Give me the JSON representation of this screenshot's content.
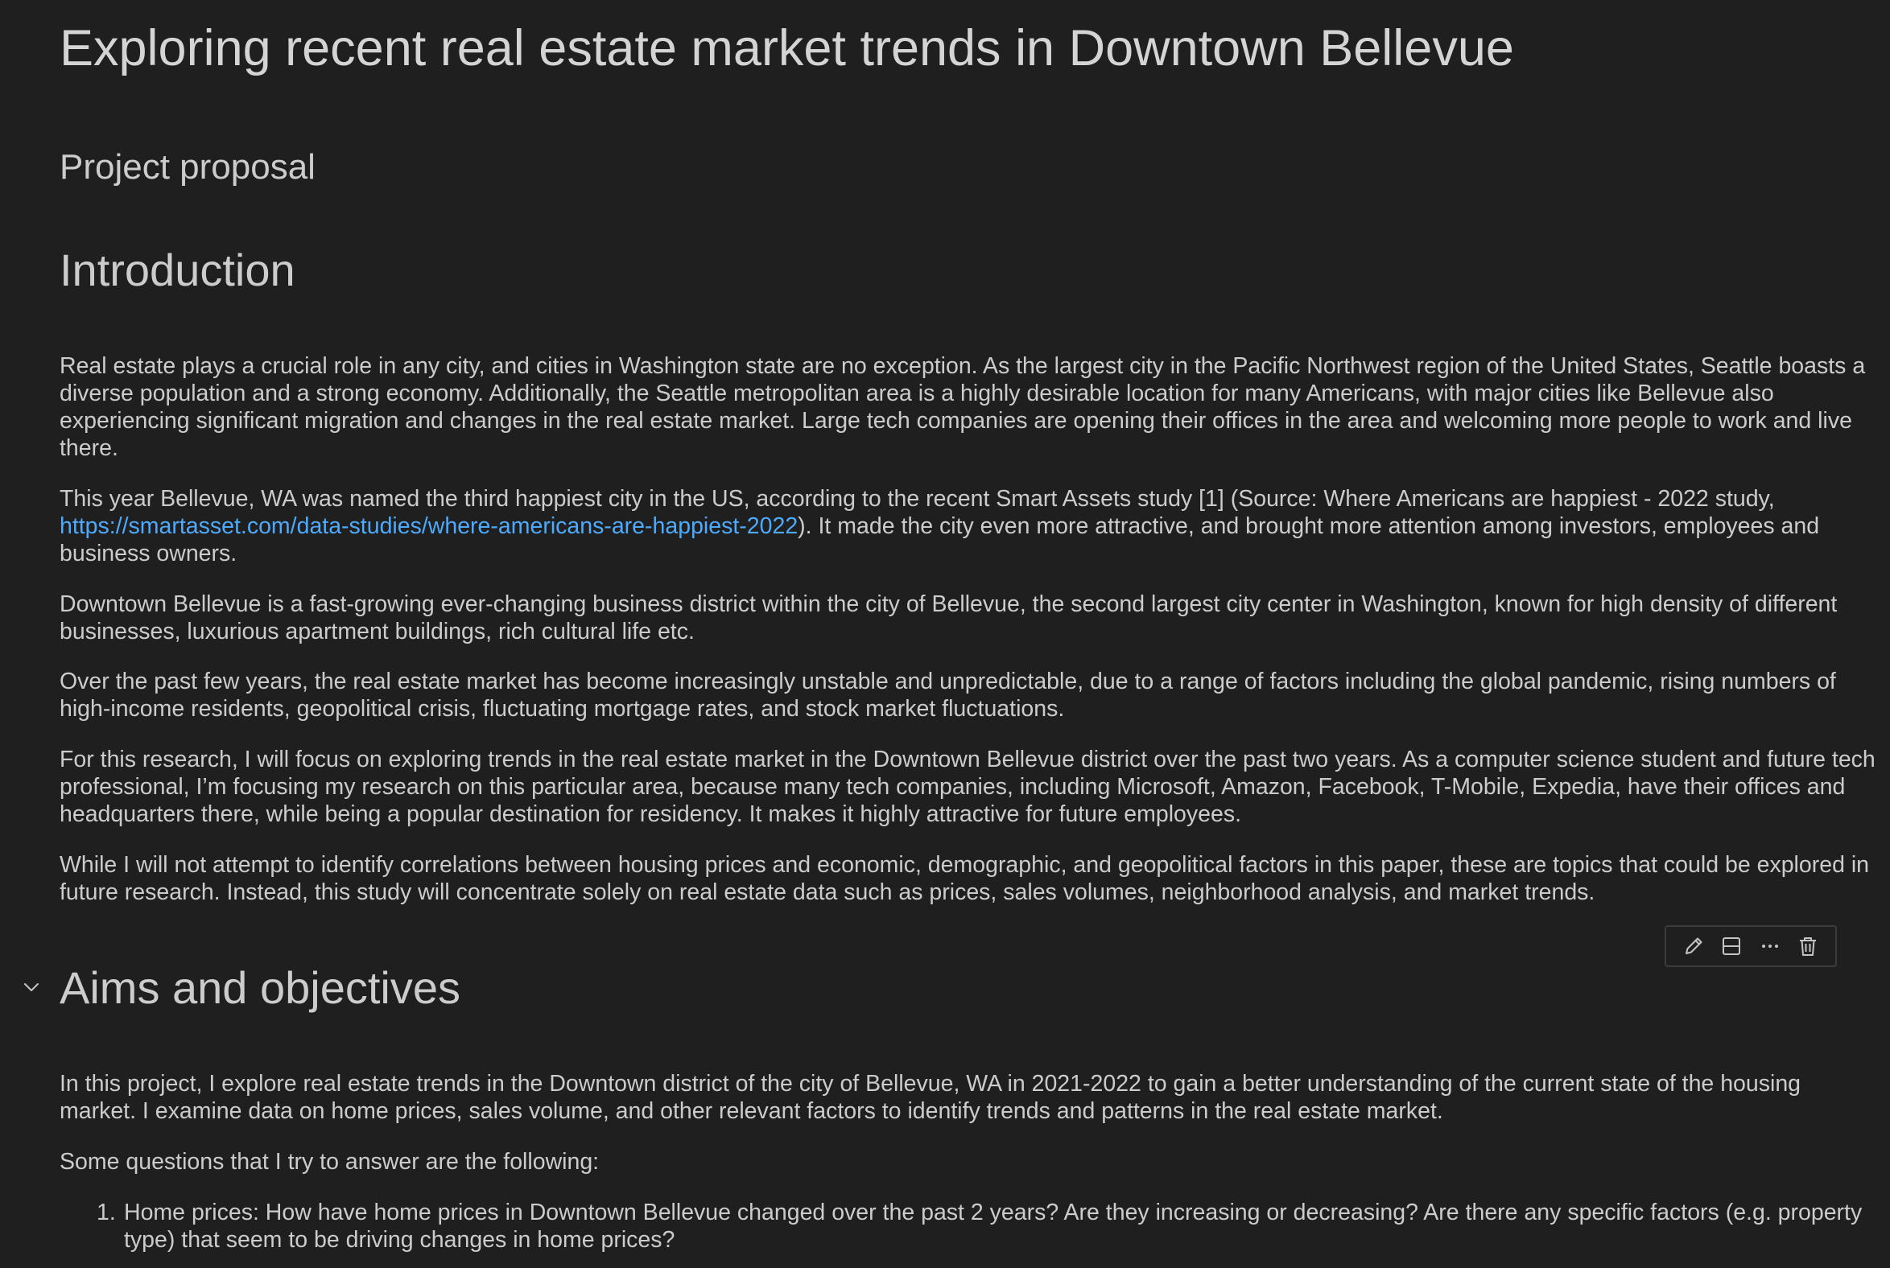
{
  "notebook": {
    "title": "Exploring recent real estate market trends in Downtown Bellevue",
    "subtitle": "Project proposal",
    "introduction": {
      "heading": "Introduction",
      "paragraphs": [
        "Real estate plays a crucial role in any city, and cities in Washington state are no exception. As the largest city in the Pacific Northwest region of the United States, Seattle boasts a diverse population and a strong economy. Additionally, the Seattle metropolitan area is a highly desirable location for many Americans, with major cities like Bellevue also experiencing significant migration and changes in the real estate market. Large tech companies are opening their offices in the area and welcoming more people to work and live there.",
        "Downtown Bellevue is a fast-growing ever-changing business district within the city of Bellevue, the second largest city center in Washington, known for high density of different businesses, luxurious apartment buildings, rich cultural life etc.",
        "Over the past few years, the real estate market has become increasingly unstable and unpredictable, due to a range of factors including the global pandemic, rising numbers of high-income residents, geopolitical crisis, fluctuating mortgage rates, and stock market fluctuations.",
        "For this research, I will focus on exploring trends in the real estate market in the Downtown Bellevue district over the past two years. As a computer science student and future tech professional, I’m focusing my research on this particular area, because many tech companies, including Microsoft, Amazon, Facebook, T-Mobile, Expedia, have their offices and headquarters there, while being a popular destination for residency. It makes it highly attractive for future employees.",
        "While I will not attempt to identify correlations between housing prices and economic, demographic, and geopolitical factors in this paper, these are topics that could be explored in future research. Instead, this study will concentrate solely on real estate data such as prices, sales volumes, neighborhood analysis, and market trends."
      ],
      "link_paragraph": {
        "before": "This year Bellevue, WA was named the third happiest city in the US, according to the recent Smart Assets study [1] (Source: Where Americans are happiest - 2022 study, ",
        "link_text": "https://smartasset.com/data-studies/where-americans-are-happiest-2022",
        "after": "). It made the city even more attractive, and brought more attention among investors, employees and business owners."
      }
    },
    "aims": {
      "heading": "Aims and objectives",
      "paragraphs": [
        "In this project, I explore real estate trends in the Downtown district of the city of Bellevue, WA in 2021-2022 to gain a better understanding of the current state of the housing market. I examine data on home prices, sales volume, and other relevant factors to identify trends and patterns in the real estate market.",
        "Some questions that I try to answer are the following:"
      ],
      "questions": [
        {
          "number": "1.",
          "text": "Home prices: How have home prices in Downtown Bellevue changed over the past 2 years? Are they increasing or decreasing? Are there any specific factors (e.g. property type) that seem to be driving changes in home prices?"
        }
      ]
    }
  },
  "cell_toolbar": {
    "icons": [
      "pencil-icon",
      "split-cell-icon",
      "more-icon",
      "trash-icon"
    ]
  },
  "colors": {
    "background": "#1f1f1f",
    "text": "#cccccc",
    "link": "#4daafc",
    "toolbar_border": "#3c3c3c"
  }
}
